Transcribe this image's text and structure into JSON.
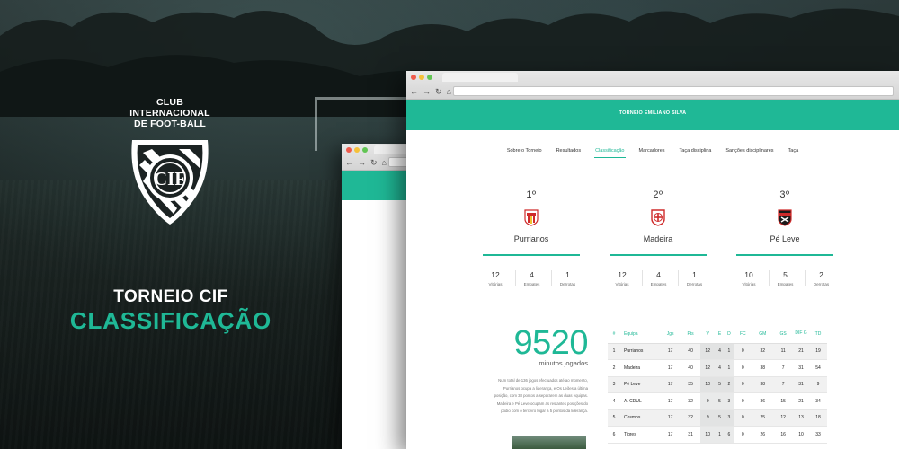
{
  "branding": {
    "club_name": [
      "CLUB",
      "INTERNACIONAL",
      "DE FOOT-BALL"
    ],
    "crest_letters": "CIF",
    "title_line1": "TORNEIO CIF",
    "title_line2": "CLASSIFICAÇÃO"
  },
  "colors": {
    "accent": "#1fb896",
    "background": "#1b2222"
  },
  "browser": {
    "nav_icons": [
      "arrow-left-icon",
      "arrow-right-icon",
      "reload-icon",
      "home-icon"
    ]
  },
  "site": {
    "header_title": "TORNEIO EMILIANO SILVA",
    "tabs": [
      {
        "label": "Sobre o Torneio",
        "active": false
      },
      {
        "label": "Resultados",
        "active": false
      },
      {
        "label": "Classificação",
        "active": true
      },
      {
        "label": "Marcadores",
        "active": false
      },
      {
        "label": "Taça disciplina",
        "active": false
      },
      {
        "label": "Sanções disciplinares",
        "active": false
      },
      {
        "label": "Taça",
        "active": false
      }
    ],
    "podium": [
      {
        "position": "1º",
        "team": "Purrianos",
        "badge": "shield-red-badge",
        "stats": [
          {
            "value": "12",
            "label": "Vitórias"
          },
          {
            "value": "4",
            "label": "Empates"
          },
          {
            "value": "1",
            "label": "Derrotas"
          }
        ]
      },
      {
        "position": "2º",
        "team": "Madeira",
        "badge": "cross-red-badge",
        "stats": [
          {
            "value": "12",
            "label": "Vitórias"
          },
          {
            "value": "4",
            "label": "Empates"
          },
          {
            "value": "1",
            "label": "Derrotas"
          }
        ]
      },
      {
        "position": "3º",
        "team": "Pé Leve",
        "badge": "striped-red-badge",
        "stats": [
          {
            "value": "10",
            "label": "Vitórias"
          },
          {
            "value": "5",
            "label": "Empates"
          },
          {
            "value": "2",
            "label": "Derrotas"
          }
        ]
      }
    ],
    "minutes": {
      "value": "9520",
      "label": "minutos jogados"
    },
    "summary_lines": [
      "Num total de 136 jogos efectuados até ao momento,",
      "Purrianos ocupa a liderança, e Os Leões a última",
      "posição, com 38 pontos a separarem as duas equipas.",
      "Madeira e Pé Leve ocupam as restantes posições do",
      "pódio com o terceiro lugar a 5 pontos da liderança."
    ],
    "table": {
      "headers": [
        "#",
        "Equipa",
        "Jgs",
        "Pts",
        "V",
        "E",
        "D",
        "FC",
        "GM",
        "GS",
        "DIF G",
        "TD"
      ],
      "rows": [
        [
          "1",
          "Purrianos",
          "17",
          "40",
          "12",
          "4",
          "1",
          "0",
          "32",
          "11",
          "21",
          "19"
        ],
        [
          "2",
          "Madeira",
          "17",
          "40",
          "12",
          "4",
          "1",
          "0",
          "38",
          "7",
          "31",
          "54"
        ],
        [
          "3",
          "Pé Leve",
          "17",
          "35",
          "10",
          "5",
          "2",
          "0",
          "38",
          "7",
          "31",
          "9"
        ],
        [
          "4",
          "A. CDUL",
          "17",
          "32",
          "9",
          "5",
          "3",
          "0",
          "36",
          "15",
          "21",
          "34"
        ],
        [
          "5",
          "Cosmos",
          "17",
          "32",
          "9",
          "5",
          "3",
          "0",
          "25",
          "12",
          "13",
          "18"
        ],
        [
          "6",
          "Tigres",
          "17",
          "31",
          "10",
          "1",
          "6",
          "0",
          "26",
          "16",
          "10",
          "33"
        ]
      ]
    }
  }
}
